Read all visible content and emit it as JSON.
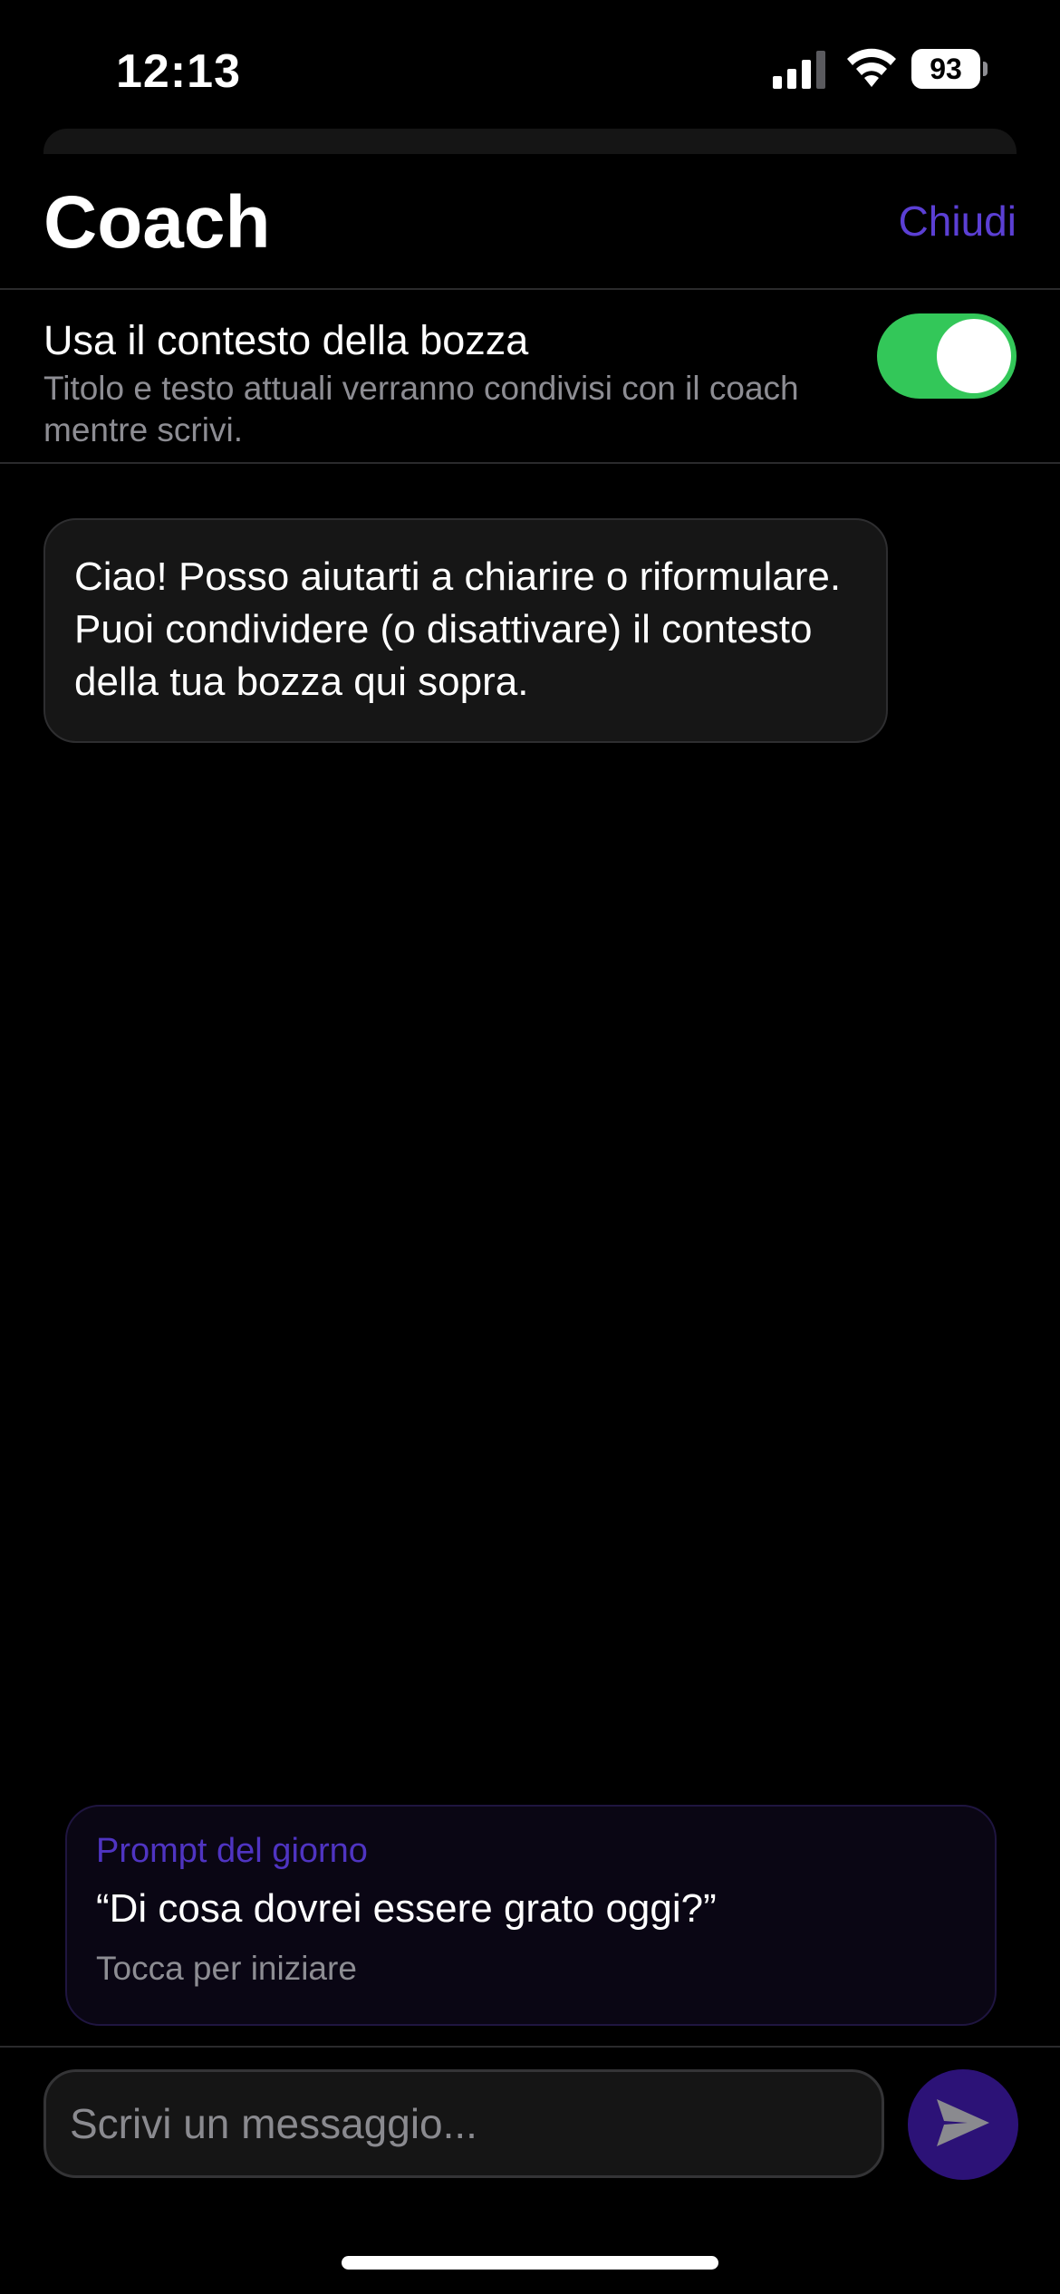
{
  "status_bar": {
    "time": "12:13",
    "battery": "93",
    "icons": [
      "cellular-signal-icon",
      "wifi-icon",
      "battery-icon"
    ]
  },
  "header": {
    "title": "Coach",
    "close_label": "Chiudi"
  },
  "context_toggle": {
    "title": "Usa il contesto della bozza",
    "description": "Titolo e testo attuali verranno condivisi con il coach mentre scrivi.",
    "enabled": true
  },
  "messages": [
    {
      "role": "assistant",
      "text": "Ciao! Posso aiutarti a chiarire o riformulare. Puoi condividere (o disattivare) il contesto della tua bozza qui sopra."
    }
  ],
  "prompt_card": {
    "kicker": "Prompt del giorno",
    "text": "“Di cosa dovrei essere grato oggi?”",
    "hint": "Tocca per iniziare"
  },
  "composer": {
    "placeholder": "Scrivi un messaggio...",
    "value": "",
    "send_icon": "paper-plane-icon"
  },
  "colors": {
    "accent": "#5b3fd4",
    "toggle_on": "#33c759",
    "send_button": "#2c1277",
    "background": "#000000"
  }
}
